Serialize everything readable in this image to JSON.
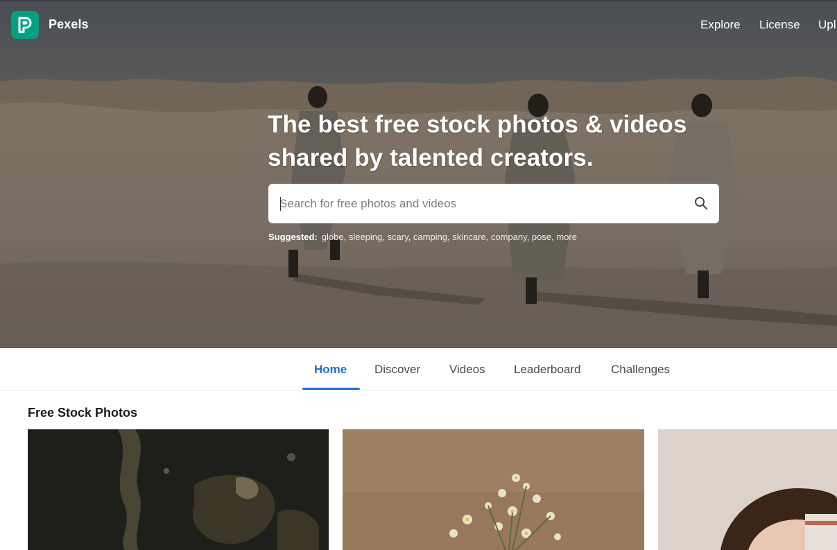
{
  "navbar": {
    "brand": "Pexels",
    "links": [
      "Explore",
      "License",
      "Upl"
    ]
  },
  "hero": {
    "title_line1": "The best free stock photos & videos",
    "title_line2": "shared by talented creators.",
    "search": {
      "placeholder": "Search for free photos and videos",
      "icon": "search-icon"
    },
    "suggested": {
      "label": "Suggested:",
      "tags": [
        "globe",
        "sleeping",
        "scary",
        "camping",
        "skincare",
        "company",
        "pose",
        "more"
      ]
    }
  },
  "tabs": {
    "items": [
      "Home",
      "Discover",
      "Videos",
      "Leaderboard",
      "Challenges"
    ],
    "active": "Home"
  },
  "gallery": {
    "section_title": "Free Stock Photos"
  },
  "colors": {
    "brand": "#05a081",
    "active_tab": "#1d6fd1"
  }
}
